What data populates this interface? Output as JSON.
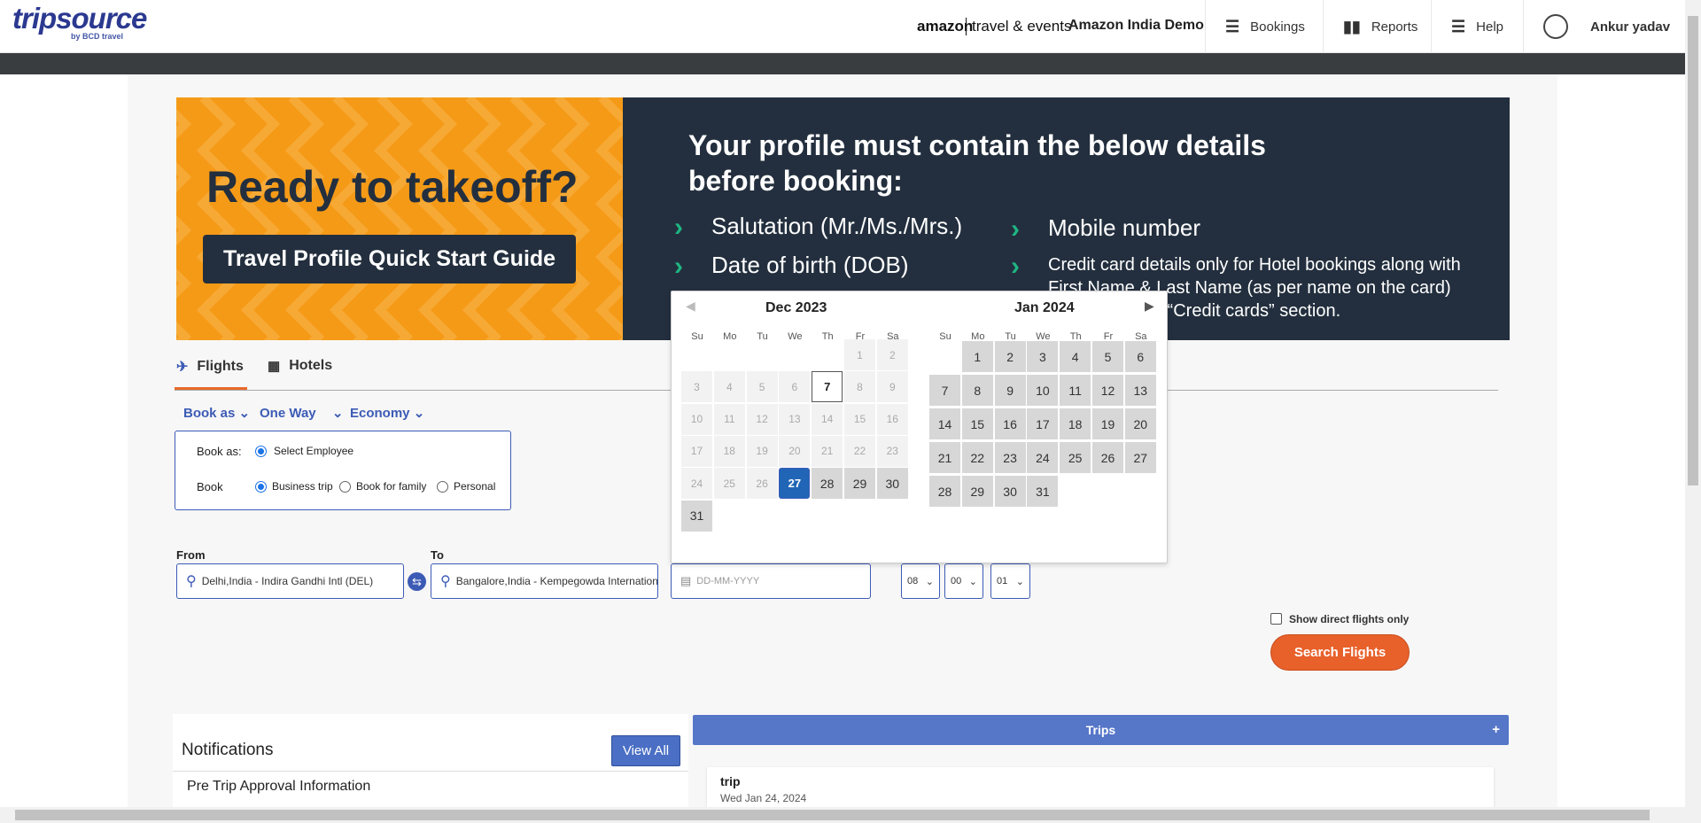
{
  "header": {
    "logo": "tripsource",
    "logo_sub": "by BCD travel",
    "amazon": "amazon",
    "amazon_te": "travel & events",
    "company": "Amazon India Demo",
    "bookings": "Bookings",
    "reports": "Reports",
    "help": "Help",
    "user": "Ankur yadav"
  },
  "banner": {
    "title": "Ready to takeoff?",
    "button": "Travel Profile Quick Start Guide",
    "heading": "Your profile must contain the below details before booking:",
    "items": [
      "Salutation (Mr./Ms./Mrs.)",
      "Date of birth (DOB)",
      "Mobile number",
      "Credit card details only for Hotel bookings along with First Name & Last Name (as per name on the card) updated under “Credit cards” section."
    ]
  },
  "tabs": {
    "flights": "Flights",
    "hotels": "Hotels"
  },
  "options": {
    "book_as": "Book as",
    "trip_type": "One Way",
    "cabin": "Economy"
  },
  "bookbox": {
    "book_as_label": "Book as:",
    "select_employee": "Select Employee",
    "book_label": "Book",
    "business_trip": "Business trip",
    "book_for_family": "Book for family",
    "personal": "Personal"
  },
  "form": {
    "from_label": "From",
    "from_value": "Delhi,India - Indira Gandhi Intl (DEL)",
    "to_label": "To",
    "to_value": "Bangalore,India - Kempegowda International",
    "date_placeholder": "DD-MM-YYYY",
    "hour": "08",
    "minute": "00",
    "pax": "01",
    "direct_only": "Show direct flights only",
    "search": "Search Flights"
  },
  "calendar": {
    "dow": [
      "Su",
      "Mo",
      "Tu",
      "We",
      "Th",
      "Fr",
      "Sa"
    ],
    "left_month": "Dec 2023",
    "right_month": "Jan 2024",
    "selected_day": "27",
    "today": "7",
    "left_days": [
      "1",
      "2",
      "3",
      "4",
      "5",
      "6",
      "7",
      "8",
      "9",
      "10",
      "11",
      "12",
      "13",
      "14",
      "15",
      "16",
      "17",
      "18",
      "19",
      "20",
      "21",
      "22",
      "23",
      "24",
      "25",
      "26",
      "27",
      "28",
      "29",
      "30",
      "31"
    ],
    "right_days": [
      "1",
      "2",
      "3",
      "4",
      "5",
      "6",
      "7",
      "8",
      "9",
      "10",
      "11",
      "12",
      "13",
      "14",
      "15",
      "16",
      "17",
      "18",
      "19",
      "20",
      "21",
      "22",
      "23",
      "24",
      "25",
      "26",
      "27",
      "28",
      "29",
      "30",
      "31"
    ]
  },
  "notifications": {
    "title": "Notifications",
    "view_all": "View All",
    "item": "Pre Trip Approval Information"
  },
  "trips": {
    "title": "Trips",
    "plus": "+",
    "card_title": "trip",
    "card_date": "Wed Jan 24, 2024"
  },
  "colors": {
    "brand": "#2b3990",
    "accent": "#e8602a",
    "selected": "#2166b6",
    "banner_dark": "#232f3e",
    "banner_orange": "#f59a17"
  }
}
